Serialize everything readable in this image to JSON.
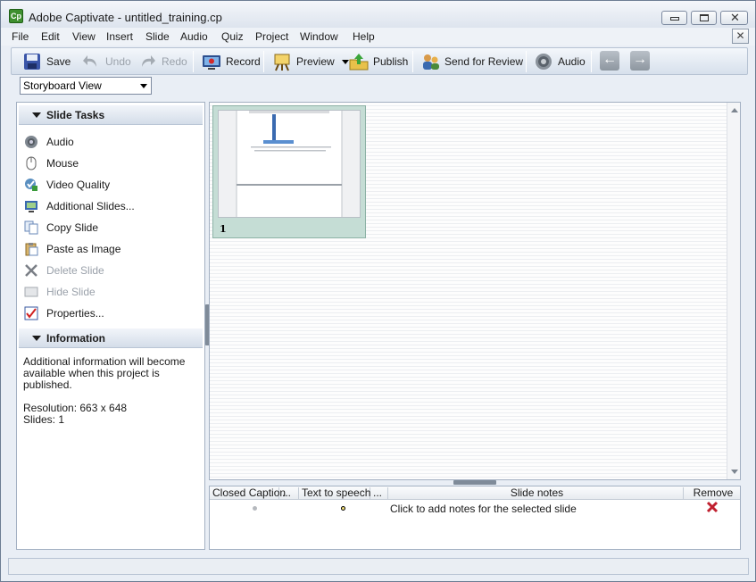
{
  "window": {
    "title": "Adobe Captivate - untitled_training.cp",
    "app_badge": "Cp"
  },
  "menu": [
    "File",
    "Edit",
    "View",
    "Insert",
    "Slide",
    "Audio",
    "Quiz",
    "Project",
    "Window",
    "Help"
  ],
  "toolbar": {
    "save": "Save",
    "undo": "Undo",
    "redo": "Redo",
    "record": "Record",
    "preview": "Preview",
    "publish": "Publish",
    "send_for_review": "Send for Review",
    "audio": "Audio"
  },
  "view_select": {
    "value": "Storyboard View"
  },
  "slide_tasks": {
    "header": "Slide Tasks",
    "items": [
      {
        "label": "Audio",
        "enabled": true,
        "icon": "speaker-icon"
      },
      {
        "label": "Mouse",
        "enabled": true,
        "icon": "mouse-icon"
      },
      {
        "label": "Video Quality",
        "enabled": true,
        "icon": "video-quality-icon"
      },
      {
        "label": "Additional Slides...",
        "enabled": true,
        "icon": "additional-slides-icon"
      },
      {
        "label": "Copy Slide",
        "enabled": true,
        "icon": "copy-icon"
      },
      {
        "label": "Paste as Image",
        "enabled": true,
        "icon": "paste-icon"
      },
      {
        "label": "Delete Slide",
        "enabled": false,
        "icon": "delete-icon"
      },
      {
        "label": "Hide Slide",
        "enabled": false,
        "icon": "hide-icon"
      },
      {
        "label": "Properties...",
        "enabled": true,
        "icon": "properties-check-icon"
      }
    ]
  },
  "information": {
    "header": "Information",
    "line1": "Additional information will become",
    "line2": "available when this project is published.",
    "resolution": "Resolution: 663 x 648",
    "slides": "Slides: 1"
  },
  "slides": [
    {
      "number": "1"
    }
  ],
  "notes_table": {
    "columns": [
      "Closed Caption",
      "...",
      "Text to speech",
      "...",
      "Slide notes",
      "Remove"
    ],
    "row": {
      "notes_placeholder": "Click to add notes for the selected slide"
    }
  },
  "colors": {
    "thumb_bg": "#c5ddd5",
    "remove_x": "#c0202f"
  }
}
